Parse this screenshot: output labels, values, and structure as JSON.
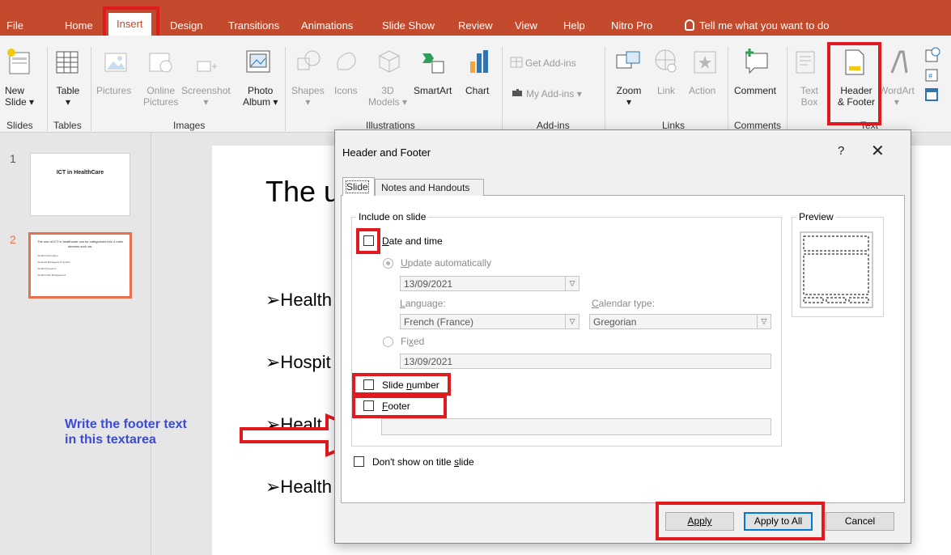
{
  "ribbon": {
    "tabs": [
      "File",
      "Home",
      "Insert",
      "Design",
      "Transitions",
      "Animations",
      "Slide Show",
      "Review",
      "View",
      "Help",
      "Nitro Pro"
    ],
    "active_tab": "Insert",
    "tell_me": "Tell me what you want to do",
    "buttons": {
      "new_slide": [
        "New",
        "Slide ▾"
      ],
      "table": [
        "Table",
        "▾"
      ],
      "pictures": "Pictures",
      "online_pictures": [
        "Online",
        "Pictures"
      ],
      "screenshot": [
        "Screenshot",
        "▾"
      ],
      "photo_album": [
        "Photo",
        "Album ▾"
      ],
      "shapes": [
        "Shapes",
        "▾"
      ],
      "icons": "Icons",
      "models_3d": [
        "3D",
        "Models ▾"
      ],
      "smartart": "SmartArt",
      "chart": "Chart",
      "get_addins": "Get Add-ins",
      "my_addins": "My Add-ins  ▾",
      "zoom": [
        "Zoom",
        "▾"
      ],
      "link": "Link",
      "action": "Action",
      "comment": "Comment",
      "text_box": [
        "Text",
        "Box"
      ],
      "header_footer": [
        "Header",
        "& Footer"
      ],
      "wordart": [
        "WordArt",
        "▾"
      ]
    },
    "groups": [
      "Slides",
      "Tables",
      "Images",
      "Illustrations",
      "Add-ins",
      "Links",
      "Comments",
      "Text"
    ]
  },
  "slides_panel": {
    "slides": [
      {
        "number": "1",
        "title": "ICT in HealthCare"
      },
      {
        "number": "2",
        "title": "The use of ICT in healthcare can be categorized into 4 main streams such as:",
        "lines": [
          "•Health Information",
          "•Hospital Management System",
          "•Health Research",
          "•Health Data Management"
        ]
      }
    ]
  },
  "slide": {
    "title": "The u",
    "bullets": [
      "➢Health",
      "➢Hospit",
      "➢Healt",
      "➢Health"
    ]
  },
  "annotation": {
    "line1": "Write the footer text",
    "line2": "in this textarea"
  },
  "dialog": {
    "title": "Header and Footer",
    "help": "?",
    "close": "✕",
    "tabs": [
      "Slide",
      "Notes and Handouts"
    ],
    "include_legend": "Include on slide",
    "date_and_time": "Date and time",
    "update_automatically": "Update automatically",
    "date_value": "13/09/2021",
    "language_label": "Language:",
    "language_value": "French (France)",
    "calendar_label": "Calendar type:",
    "calendar_value": "Gregorian",
    "fixed_label": "Fixed",
    "fixed_value": "13/09/2021",
    "slide_number": "Slide number",
    "footer": "Footer",
    "footer_text": "",
    "dont_show": "Don't show on title slide",
    "preview_legend": "Preview",
    "apply": "Apply",
    "apply_to_all": "Apply to All",
    "cancel": "Cancel"
  },
  "colors": {
    "ribbon": "#c34a2c",
    "highlight": "#e11a1f",
    "annotation": "#3a4bd6",
    "selected_thumb": "#e6714e"
  }
}
